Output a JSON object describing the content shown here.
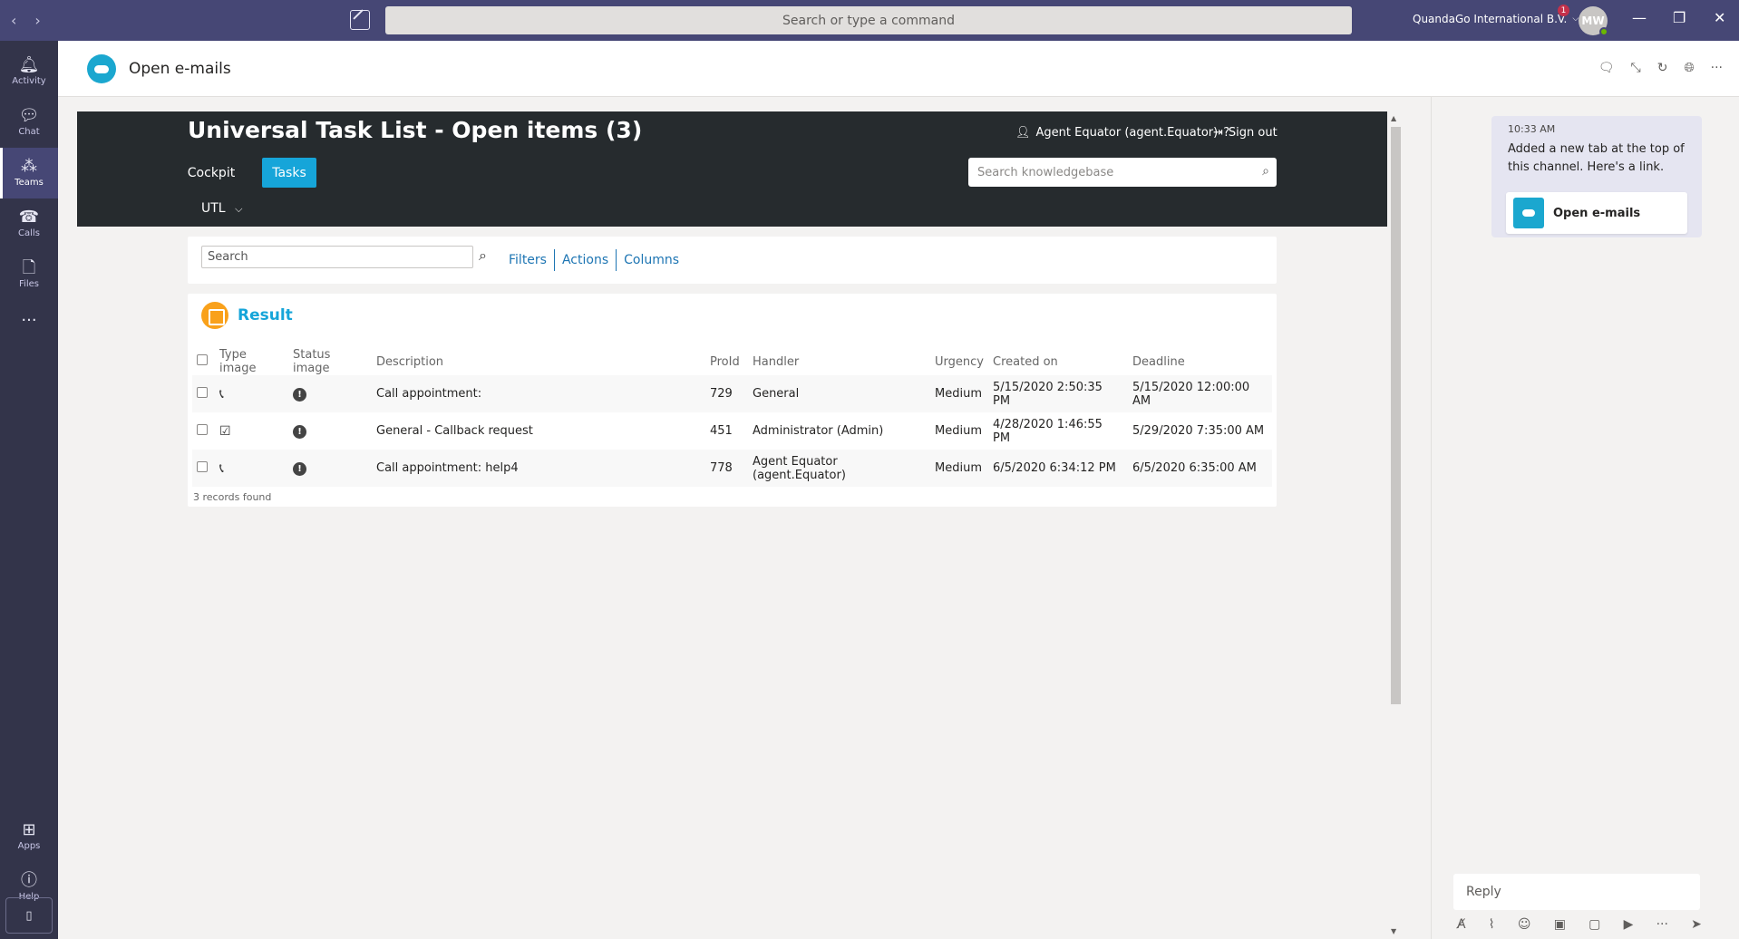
{
  "titlebar": {
    "command_placeholder": "Search or type a command",
    "org_name": "QuandaGo International B.V.",
    "notification_count": "1",
    "avatar_initials": "MW"
  },
  "rail": {
    "items": [
      {
        "label": "Activity"
      },
      {
        "label": "Chat"
      },
      {
        "label": "Teams"
      },
      {
        "label": "Calls"
      },
      {
        "label": "Files"
      },
      {
        "label": "Apps"
      },
      {
        "label": "Help"
      }
    ]
  },
  "app": {
    "title": "Open e-mails"
  },
  "utl": {
    "title": "Universal Task List - Open items (3)",
    "tabs": [
      "Cockpit",
      "Tasks"
    ],
    "dropdown": "UTL",
    "agent": "Agent Equator (agent.Equator)",
    "sign_out": "Sign out",
    "kb_placeholder": "Search knowledgebase"
  },
  "filters": {
    "search_placeholder": "Search",
    "links": [
      "Filters",
      "Actions",
      "Columns"
    ]
  },
  "result": {
    "title": "Result",
    "columns": [
      "Type image",
      "Status image",
      "Description",
      "ProId",
      "Handler",
      "Urgency",
      "Created on",
      "Deadline"
    ],
    "rows": [
      {
        "type": "phone",
        "description": "Call appointment:",
        "proid": "729",
        "handler": "General",
        "urgency": "Medium",
        "created": "5/15/2020 2:50:35 PM",
        "deadline": "5/15/2020 12:00:00 AM"
      },
      {
        "type": "task",
        "description": "General - Callback request",
        "proid": "451",
        "handler": "Administrator (Admin)",
        "urgency": "Medium",
        "created": "4/28/2020 1:46:55 PM",
        "deadline": "5/29/2020 7:35:00 AM"
      },
      {
        "type": "phone",
        "description": "Call appointment: help4",
        "proid": "778",
        "handler": "Agent Equator (agent.Equator)",
        "urgency": "Medium",
        "created": "6/5/2020 6:34:12 PM",
        "deadline": "6/5/2020 6:35:00 AM"
      }
    ],
    "records_found": "3 records found"
  },
  "conversation": {
    "time": "10:33 AM",
    "text": "Added a new tab at the top of this channel. Here's a link.",
    "card_label": "Open e-mails",
    "reply_placeholder": "Reply"
  }
}
